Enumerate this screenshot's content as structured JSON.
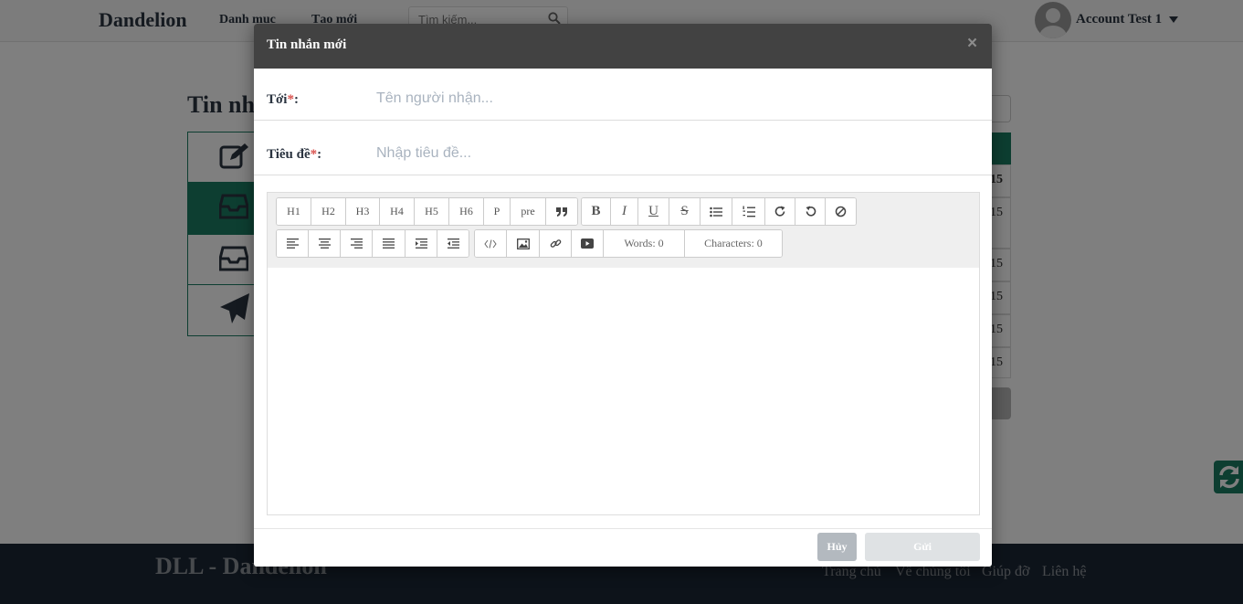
{
  "navbar": {
    "brand": "Dandelion",
    "links": [
      "Danh mục",
      "Tạo mới"
    ],
    "search_placeholder": "Tìm kiếm...",
    "account_name": "Account Test 1"
  },
  "page": {
    "title": "Tin nhắn",
    "table_values": [
      "15",
      "15",
      "15",
      "15",
      "15",
      "15"
    ]
  },
  "footer": {
    "brand": "DLL - Dandelion",
    "links": [
      "Trang chủ",
      "Về chúng tôi",
      "Giúp đỡ",
      "Liên hệ"
    ]
  },
  "modal": {
    "title": "Tin nhắn mới",
    "close_glyph": "×",
    "to_label": "Tới",
    "to_placeholder": "Tên người nhận...",
    "to_value": "",
    "subject_label": "Tiêu đề",
    "subject_placeholder": "Nhập tiêu đề...",
    "subject_value": "",
    "required_mark": "*",
    "colon": ":",
    "toolbar": {
      "row1": [
        "H1",
        "H2",
        "H3",
        "H4",
        "H5",
        "H6",
        "P",
        "pre"
      ],
      "format": [
        "B",
        "I",
        "U",
        "S"
      ],
      "words": "Words: 0",
      "characters": "Characters: 0"
    },
    "body_value": "",
    "cancel_label": "Hủy",
    "send_label": "Gửi"
  },
  "colors": {
    "brand_green": "#1a7d63",
    "modal_header": "#424242",
    "footer_bg": "#1b2634"
  }
}
